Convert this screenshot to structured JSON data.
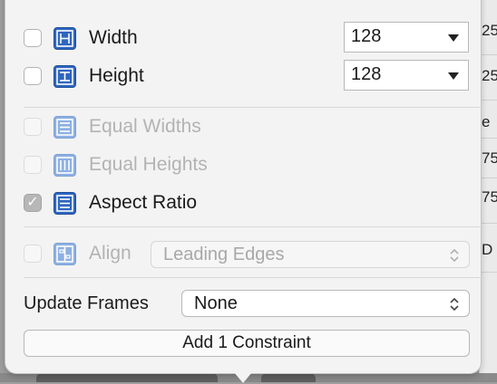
{
  "background": {
    "right_ticks": [
      "25",
      "25",
      "e",
      "75",
      "75",
      "D"
    ]
  },
  "size": {
    "width": {
      "label": "Width",
      "value": "128",
      "checked": false
    },
    "height": {
      "label": "Height",
      "value": "128",
      "checked": false
    }
  },
  "relations": [
    {
      "label": "Equal Widths",
      "enabled": false,
      "checked": false
    },
    {
      "label": "Equal Heights",
      "enabled": false,
      "checked": false
    },
    {
      "label": "Aspect Ratio",
      "enabled": true,
      "checked": true
    }
  ],
  "align": {
    "label": "Align",
    "value": "Leading Edges",
    "enabled": false
  },
  "update_frames": {
    "label": "Update Frames",
    "value": "None"
  },
  "add_button": {
    "label": "Add 1 Constraint"
  },
  "colors": {
    "icon": "#2f66bf",
    "icon_disabled": "#8db0e3"
  }
}
